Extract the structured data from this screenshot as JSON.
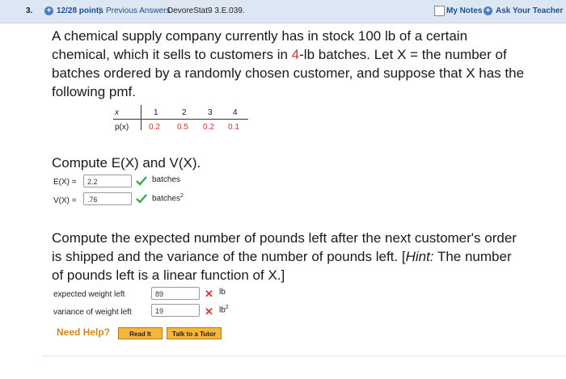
{
  "header": {
    "question_number": "3.",
    "points": "12/28 points",
    "separator": "|",
    "previous_answers": "Previous Answers",
    "problem_code": "DevoreStat9 3.E.039.",
    "my_notes": "My Notes",
    "ask_teacher": "Ask Your Teacher"
  },
  "problem": {
    "line1": "A chemical supply company currently has in stock 100 lb of a certain",
    "line2_a": "chemical, which it sells to customers in ",
    "line2_red": "4",
    "line2_b": "-lb batches. Let X = the number of",
    "line3": "batches ordered by a randomly chosen customer, and suppose that X has the",
    "line4": "following pmf."
  },
  "pmf_table": {
    "x_label": "x",
    "p_label": "p(x)",
    "x_values": [
      "1",
      "2",
      "3",
      "4"
    ],
    "p_values": [
      "0.2",
      "0.5",
      "0.2",
      "0.1"
    ]
  },
  "part1": {
    "prompt": "Compute E(X) and V(X).",
    "ex_label": "E(X) =",
    "ex_value": "2.2",
    "ex_unit": "batches",
    "vx_label": "V(X) =",
    "vx_value": ".76",
    "vx_unit": "batches",
    "vx_unit_sup": "2"
  },
  "part2": {
    "line1": "Compute the expected number of pounds left after the next customer's order",
    "line2_a": "is shipped and the variance of the number of pounds left. [",
    "line2_hint": "Hint:",
    "line2_b": " The number",
    "line3": "of pounds left is a linear function of X.]",
    "expected_label": "expected weight left",
    "expected_value": "89",
    "expected_unit": "lb",
    "variance_label": "variance of weight left",
    "variance_value": "19",
    "variance_unit": "lb",
    "variance_unit_sup": "2"
  },
  "help": {
    "need_help": "Need Help?",
    "read_it": "Read It",
    "talk_tutor": "Talk to a Tutor"
  },
  "colors": {
    "correct": "#3aa655",
    "incorrect": "#d03a2b",
    "link": "#1d4f8e",
    "button": "#f5b73b"
  }
}
